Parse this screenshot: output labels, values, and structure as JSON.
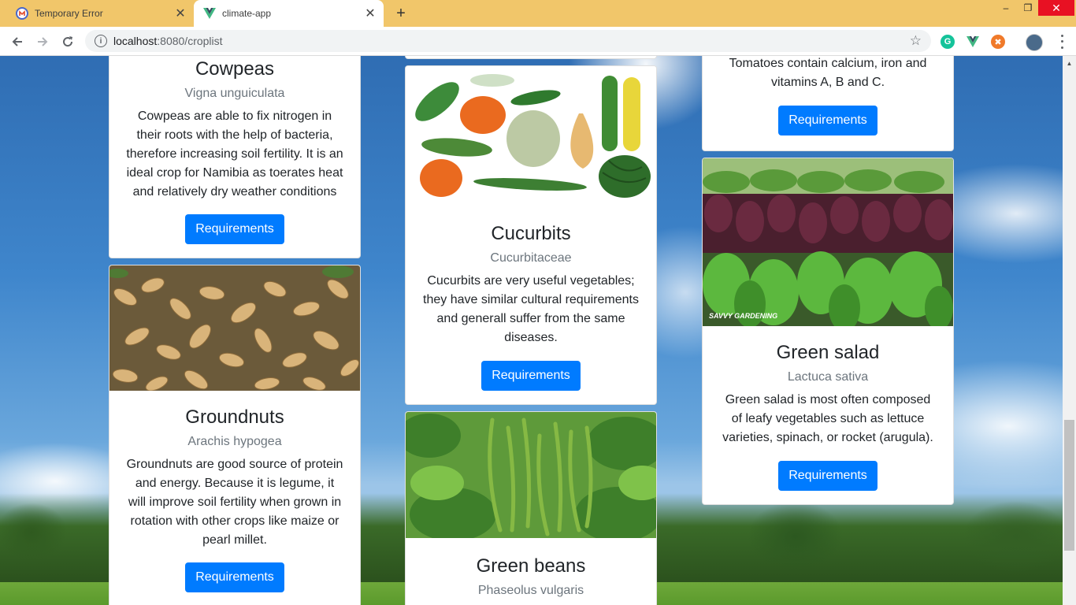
{
  "browser": {
    "tabs": [
      {
        "title": "Temporary Error",
        "active": false
      },
      {
        "title": "climate-app",
        "active": true
      }
    ],
    "new_tab": "+",
    "window_controls": {
      "minimize": "–",
      "restore": "❐",
      "close": "✕"
    },
    "url": {
      "host": "localhost",
      "path": ":8080/croplist"
    },
    "icons": [
      "back-icon",
      "forward-icon",
      "reload-icon",
      "info-icon",
      "star-icon",
      "grammarly-icon",
      "vue-devtools-icon",
      "extension-icon",
      "profile-avatar",
      "menu-icon"
    ]
  },
  "cards": {
    "cowpeas": {
      "name": "Cowpeas",
      "scientific": "Vigna unguiculata",
      "description": "Cowpeas are able to fix nitrogen in their roots with the help of bacteria, therefore increasing soil fertility. It is an ideal crop for Namibia as toerates heat and relatively dry weather conditions",
      "button": "Requirements"
    },
    "groundnuts": {
      "name": "Groundnuts",
      "scientific": "Arachis hypogea",
      "description": "Groundnuts are good source of protein and energy. Because it is legume, it will improve soil fertility when grown in rotation with other crops like maize or pearl millet.",
      "button": "Requirements"
    },
    "cucurbits": {
      "name": "Cucurbits",
      "scientific": "Cucurbitaceae",
      "description": "Cucurbits are very useful vegetables; they have similar cultural requirements and generall suffer from the same diseases.",
      "button": "Requirements"
    },
    "green_beans": {
      "name": "Green beans",
      "scientific": "Phaseolus vulgaris"
    },
    "tomatoes": {
      "description": "Tomatoes contain calcium, iron and vitamins A, B and C.",
      "button": "Requirements"
    },
    "green_salad": {
      "name": "Green salad",
      "scientific": "Lactuca sativa",
      "description": "Green salad is most often composed of leafy vegetables such as lettuce varieties, spinach, or rocket (arugula).",
      "button": "Requirements",
      "image_watermark": "SAVVY GARDENING"
    }
  },
  "colors": {
    "tabstrip": "#f1c66a",
    "button": "#007bff",
    "sky": "#3f86cc"
  }
}
